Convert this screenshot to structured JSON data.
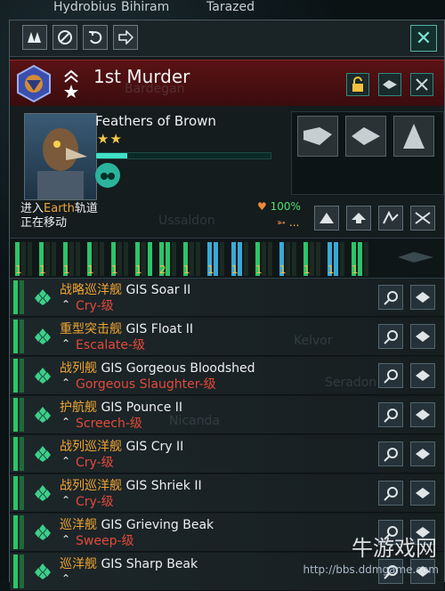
{
  "map": {
    "top_labels": [
      "Hydrobius",
      "Bihiram",
      "Tarazed"
    ],
    "background_labels": [
      "Bardegan",
      "Ussaldon",
      "Kelvor",
      "Seradon",
      "Nicanda"
    ]
  },
  "toolbar": {
    "buttons": [
      "fleet-formation",
      "disband",
      "undo",
      "move"
    ],
    "close_label": "✕"
  },
  "fleet": {
    "name": "1st Murder",
    "leader_name": "Feathers of Brown",
    "leader_stars": "★★",
    "xp": 0.18,
    "status_line1_a": "进入",
    "status_line1_place": "Earth",
    "status_line1_b": "轨道",
    "status_line2": "正在移动",
    "hp": "100%",
    "eta": "..."
  },
  "composition": [
    {
      "count": "1"
    },
    {
      "count": "1"
    },
    {
      "count": "1"
    },
    {
      "count": "1"
    },
    {
      "count": "1"
    },
    {
      "count": "1"
    },
    {
      "count": "2"
    },
    {
      "count": "1"
    },
    {
      "count": "1"
    },
    {
      "count": "1"
    },
    {
      "count": "1"
    },
    {
      "count": "1"
    },
    {
      "count": "1"
    },
    {
      "count": "1"
    },
    {
      "count": "1"
    }
  ],
  "ships": [
    {
      "class": "战略巡洋舰",
      "name": "GIS Soar II",
      "sub": "Cry-级"
    },
    {
      "class": "重型突击舰",
      "name": "GIS Float II",
      "sub": "Escalate-级"
    },
    {
      "class": "战列舰",
      "name": "GIS Gorgeous Bloodshed",
      "sub": "Gorgeous Slaughter-级"
    },
    {
      "class": "护航舰",
      "name": "GIS Pounce II",
      "sub": "Screech-级"
    },
    {
      "class": "战列巡洋舰",
      "name": "GIS Cry II",
      "sub": "Cry-级"
    },
    {
      "class": "战列巡洋舰",
      "name": "GIS Shriek II",
      "sub": "Cry-级"
    },
    {
      "class": "巡洋舰",
      "name": "GIS Grieving Beak",
      "sub": "Sweep-级"
    },
    {
      "class": "巡洋舰",
      "name": "GIS Sharp Beak",
      "sub": ""
    }
  ],
  "watermark": {
    "url": "http://bbs.ddmgame.com",
    "cn": "牛游戏网"
  }
}
